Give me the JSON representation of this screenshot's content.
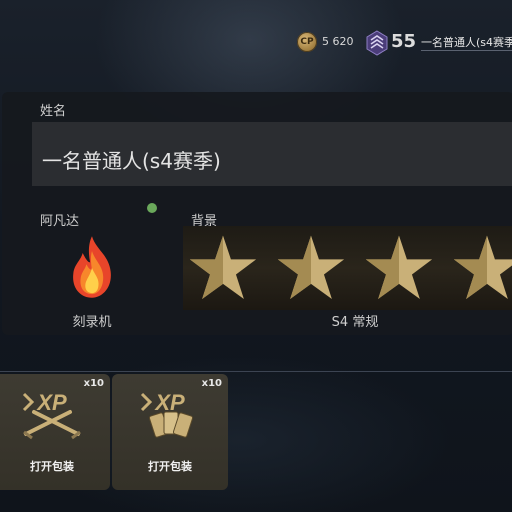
{
  "topbar": {
    "cp_icon_text": "CP",
    "cp_amount": "5 620",
    "rank_icon": "rank-chevron-badge-icon",
    "level": "55",
    "player_name": "一名普通人(s4赛季"
  },
  "profile": {
    "name_label": "姓名",
    "name_value": "一名普通人(s4赛季)",
    "avatar_label": "阿凡达",
    "avatar_item_name": "刻录机",
    "avatar_icon": "fire-icon",
    "background_label": "背景",
    "background_item_name": "S4 常规",
    "background_icon": "gold-stars-icon"
  },
  "packs": [
    {
      "count": "x10",
      "label": "打开包装",
      "icon": "xp-crossed-knives-icon"
    },
    {
      "count": "x10",
      "label": "打开包装",
      "icon": "xp-cards-icon"
    }
  ],
  "colors": {
    "panel": "#16191e",
    "field": "#2b2d31",
    "gold": "#c9b078",
    "card": "#3a372e",
    "status_dot": "#6aa85b"
  }
}
